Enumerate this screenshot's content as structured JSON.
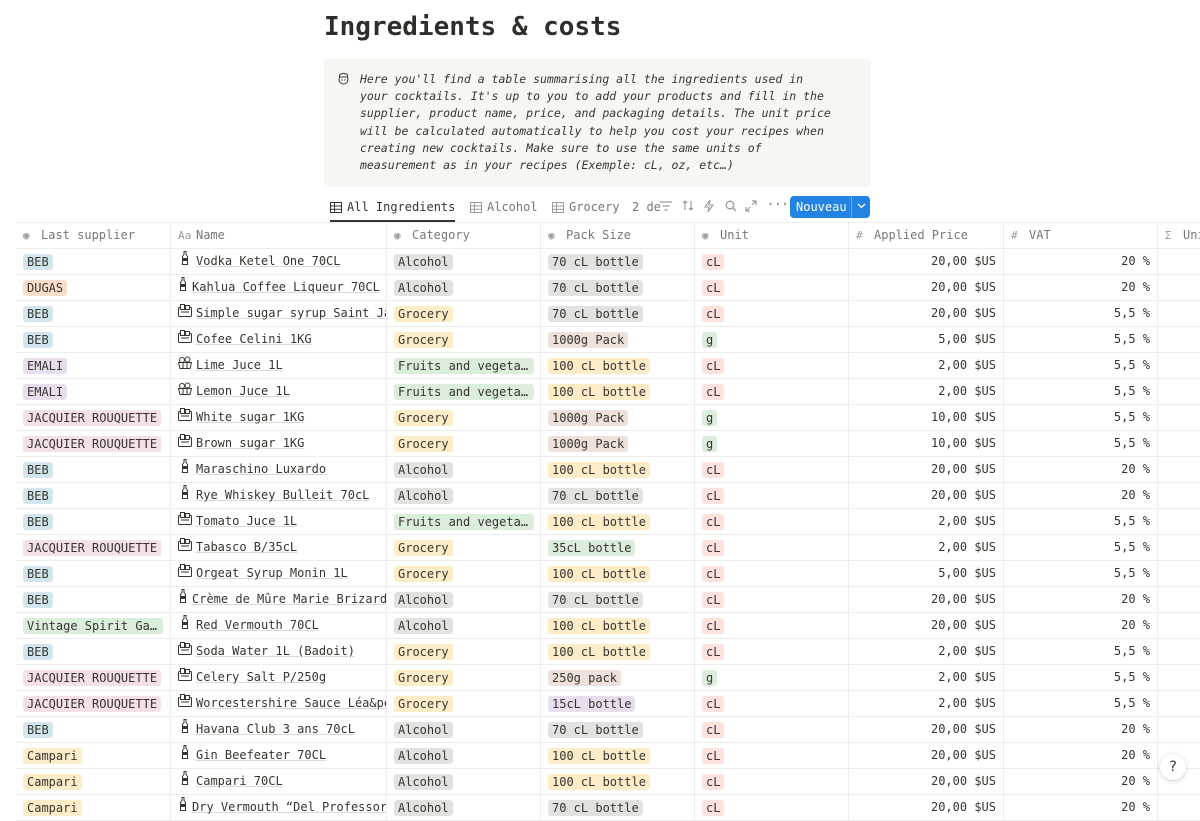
{
  "page": {
    "title": "Ingredients & costs",
    "callout_icon": "chef-emoji-icon",
    "callout_text": "Here you'll find a table summarising all the ingredients used in\nyour cocktails. It's up to you to add your products and fill in the\nsupplier, product name, price, and packaging details. The unit price\nwill be calculated automatically to help you cost your recipes when\ncreating new cocktails. Make sure to use the same units of\nmeasurement as in your recipes (Exemple: cL, oz, etc…)"
  },
  "views": {
    "tabs": [
      {
        "label": "All Ingredients",
        "active": true
      },
      {
        "label": "Alcohol",
        "active": false
      },
      {
        "label": "Grocery",
        "active": false
      }
    ],
    "more_views_label": "2 de",
    "new_button_label": "Nouveau"
  },
  "table": {
    "columns": [
      {
        "label": "Last supplier",
        "icon": "select-icon"
      },
      {
        "label": "Name",
        "icon": "title-icon"
      },
      {
        "label": "Category",
        "icon": "select-icon"
      },
      {
        "label": "Pack Size",
        "icon": "select-icon"
      },
      {
        "label": "Unit",
        "icon": "select-icon"
      },
      {
        "label": "Applied Price",
        "icon": "number-icon"
      },
      {
        "label": "VAT",
        "icon": "number-icon"
      },
      {
        "label": "Uni",
        "icon": "formula-icon"
      }
    ],
    "tag_colors": {
      "blue": "#d3e5ef",
      "orange": "#fadec9",
      "purple": "#e8deee",
      "pink": "#f5e0e9",
      "green": "#dbeddb",
      "yellow": "#fdecc8",
      "gray": "#e3e2e0",
      "brown": "#eee0da",
      "red": "#ffe2dd"
    },
    "rows": [
      {
        "supplier": "BEB",
        "supplier_color": "blue",
        "icon": "bottle-icon",
        "name": "Vodka Ketel One 70CL",
        "category": "Alcohol",
        "category_color": "gray",
        "pack": "70 cL bottle",
        "pack_color": "gray",
        "unit": "cL",
        "unit_color": "red",
        "price": "20,00 $US",
        "vat": "20 %"
      },
      {
        "supplier": "DUGAS",
        "supplier_color": "orange",
        "icon": "bottle-icon",
        "name": "Kahlua Coffee Liqueur 70CL",
        "category": "Alcohol",
        "category_color": "gray",
        "pack": "70 cL bottle",
        "pack_color": "gray",
        "unit": "cL",
        "unit_color": "red",
        "price": "20,00 $US",
        "vat": "20 %"
      },
      {
        "supplier": "BEB",
        "supplier_color": "blue",
        "icon": "grocery-icon",
        "name": "Simple sugar syrup Saint Jam",
        "category": "Grocery",
        "category_color": "yellow",
        "pack": "70 cL bottle",
        "pack_color": "gray",
        "unit": "cL",
        "unit_color": "red",
        "price": "20,00 $US",
        "vat": "5,5 %"
      },
      {
        "supplier": "BEB",
        "supplier_color": "blue",
        "icon": "grocery-icon",
        "name": "Cofee Celini 1KG",
        "category": "Grocery",
        "category_color": "yellow",
        "pack": "1000g Pack",
        "pack_color": "brown",
        "unit": "g",
        "unit_color": "green",
        "price": "5,00 $US",
        "vat": "5,5 %"
      },
      {
        "supplier": "EMALI",
        "supplier_color": "purple",
        "icon": "fruit-basket-icon",
        "name": "Lime Juce 1L",
        "category": "Fruits and vegetables",
        "category_color": "green",
        "pack": "100 cL bottle",
        "pack_color": "yellow",
        "unit": "cL",
        "unit_color": "red",
        "price": "2,00 $US",
        "vat": "5,5 %"
      },
      {
        "supplier": "EMALI",
        "supplier_color": "purple",
        "icon": "fruit-basket-icon",
        "name": "Lemon Juce 1L",
        "category": "Fruits and vegetables",
        "category_color": "green",
        "pack": "100 cL bottle",
        "pack_color": "yellow",
        "unit": "cL",
        "unit_color": "red",
        "price": "2,00 $US",
        "vat": "5,5 %"
      },
      {
        "supplier": "JACQUIER ROUQUETTE",
        "supplier_color": "pink",
        "icon": "grocery-icon",
        "name": "White sugar 1KG",
        "category": "Grocery",
        "category_color": "yellow",
        "pack": "1000g Pack",
        "pack_color": "brown",
        "unit": "g",
        "unit_color": "green",
        "price": "10,00 $US",
        "vat": "5,5 %"
      },
      {
        "supplier": "JACQUIER ROUQUETTE",
        "supplier_color": "pink",
        "icon": "grocery-icon",
        "name": "Brown sugar 1KG",
        "category": "Grocery",
        "category_color": "yellow",
        "pack": "1000g Pack",
        "pack_color": "brown",
        "unit": "g",
        "unit_color": "green",
        "price": "10,00 $US",
        "vat": "5,5 %"
      },
      {
        "supplier": "BEB",
        "supplier_color": "blue",
        "icon": "bottle-icon",
        "name": "Maraschino Luxardo",
        "category": "Alcohol",
        "category_color": "gray",
        "pack": "100 cL bottle",
        "pack_color": "yellow",
        "unit": "cL",
        "unit_color": "red",
        "price": "20,00 $US",
        "vat": "20 %"
      },
      {
        "supplier": "BEB",
        "supplier_color": "blue",
        "icon": "bottle-icon",
        "name": "Rye Whiskey Bulleit 70cL",
        "category": "Alcohol",
        "category_color": "gray",
        "pack": "70 cL bottle",
        "pack_color": "gray",
        "unit": "cL",
        "unit_color": "red",
        "price": "20,00 $US",
        "vat": "20 %"
      },
      {
        "supplier": "BEB",
        "supplier_color": "blue",
        "icon": "grocery-icon",
        "name": "Tomato Juce 1L",
        "category": "Fruits and vegetables",
        "category_color": "green",
        "pack": "100 cL bottle",
        "pack_color": "yellow",
        "unit": "cL",
        "unit_color": "red",
        "price": "2,00 $US",
        "vat": "5,5 %"
      },
      {
        "supplier": "JACQUIER ROUQUETTE",
        "supplier_color": "pink",
        "icon": "grocery-icon",
        "name": "Tabasco B/35cL",
        "category": "Grocery",
        "category_color": "yellow",
        "pack": "35cL bottle",
        "pack_color": "green",
        "unit": "cL",
        "unit_color": "red",
        "price": "2,00 $US",
        "vat": "5,5 %"
      },
      {
        "supplier": "BEB",
        "supplier_color": "blue",
        "icon": "grocery-icon",
        "name": "Orgeat Syrup Monin 1L",
        "category": "Grocery",
        "category_color": "yellow",
        "pack": "100 cL bottle",
        "pack_color": "yellow",
        "unit": "cL",
        "unit_color": "red",
        "price": "5,00 $US",
        "vat": "5,5 %"
      },
      {
        "supplier": "BEB",
        "supplier_color": "blue",
        "icon": "bottle-icon",
        "name": "Crème de Mûre Marie Brizard",
        "category": "Alcohol",
        "category_color": "gray",
        "pack": "70 cL bottle",
        "pack_color": "gray",
        "unit": "cL",
        "unit_color": "red",
        "price": "20,00 $US",
        "vat": "20 %"
      },
      {
        "supplier": "Vintage Spirit Gallery",
        "supplier_color": "green",
        "icon": "bottle-icon",
        "name": "Red Vermouth 70CL",
        "category": "Alcohol",
        "category_color": "gray",
        "pack": "100 cL bottle",
        "pack_color": "yellow",
        "unit": "cL",
        "unit_color": "red",
        "price": "20,00 $US",
        "vat": "20 %"
      },
      {
        "supplier": "BEB",
        "supplier_color": "blue",
        "icon": "grocery-icon",
        "name": "Soda Water 1L (Badoit)",
        "category": "Grocery",
        "category_color": "yellow",
        "pack": "100 cL bottle",
        "pack_color": "yellow",
        "unit": "cL",
        "unit_color": "red",
        "price": "2,00 $US",
        "vat": "5,5 %"
      },
      {
        "supplier": "JACQUIER ROUQUETTE",
        "supplier_color": "pink",
        "icon": "grocery-icon",
        "name": "Celery Salt P/250g",
        "category": "Grocery",
        "category_color": "yellow",
        "pack": "250g pack",
        "pack_color": "brown",
        "unit": "g",
        "unit_color": "green",
        "price": "2,00 $US",
        "vat": "5,5 %"
      },
      {
        "supplier": "JACQUIER ROUQUETTE",
        "supplier_color": "pink",
        "icon": "grocery-icon",
        "name": "Worcestershire Sauce Léa&perrins",
        "category": "Grocery",
        "category_color": "yellow",
        "pack": "15cL bottle",
        "pack_color": "purple",
        "unit": "cL",
        "unit_color": "red",
        "price": "2,00 $US",
        "vat": "5,5 %"
      },
      {
        "supplier": "BEB",
        "supplier_color": "blue",
        "icon": "bottle-icon",
        "name": "Havana Club 3 ans 70cL",
        "category": "Alcohol",
        "category_color": "gray",
        "pack": "70 cL bottle",
        "pack_color": "gray",
        "unit": "cL",
        "unit_color": "red",
        "price": "20,00 $US",
        "vat": "20 %"
      },
      {
        "supplier": "Campari",
        "supplier_color": "yellow",
        "icon": "bottle-icon",
        "name": "Gin Beefeater 70CL",
        "category": "Alcohol",
        "category_color": "gray",
        "pack": "100 cL bottle",
        "pack_color": "yellow",
        "unit": "cL",
        "unit_color": "red",
        "price": "20,00 $US",
        "vat": "20 %"
      },
      {
        "supplier": "Campari",
        "supplier_color": "yellow",
        "icon": "bottle-icon",
        "name": "Campari 70CL",
        "category": "Alcohol",
        "category_color": "gray",
        "pack": "100 cL bottle",
        "pack_color": "yellow",
        "unit": "cL",
        "unit_color": "red",
        "price": "20,00 $US",
        "vat": "20 %"
      },
      {
        "supplier": "Campari",
        "supplier_color": "yellow",
        "icon": "bottle-icon",
        "name": "Dry Vermouth “Del Professore”",
        "category": "Alcohol",
        "category_color": "gray",
        "pack": "70 cL bottle",
        "pack_color": "gray",
        "unit": "cL",
        "unit_color": "red",
        "price": "20,00 $US",
        "vat": "20 %"
      }
    ]
  },
  "help_button_label": "?"
}
